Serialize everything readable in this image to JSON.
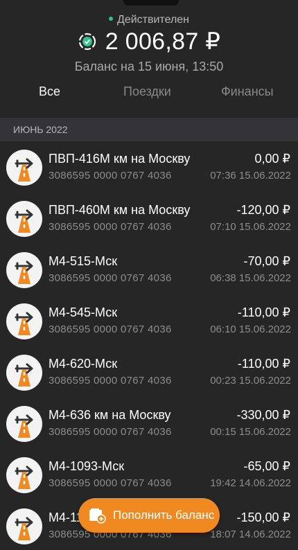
{
  "header": {
    "status": "Действителен",
    "balance": "2 006,87 ₽",
    "balance_date": "Баланс на 15 июня, 13:50"
  },
  "tabs": [
    {
      "label": "Все",
      "active": true
    },
    {
      "label": "Поездки",
      "active": false
    },
    {
      "label": "Финансы",
      "active": false
    }
  ],
  "month": "ИЮНЬ 2022",
  "transactions": [
    {
      "title": "ПВП-416М км на Москву",
      "card": "3086595 0000 0767 4036",
      "amount": "0,00 ₽",
      "datetime": "07:36 15.06.2022"
    },
    {
      "title": "ПВП-460М км на Москву",
      "card": "3086595 0000 0767 4036",
      "amount": "-120,00 ₽",
      "datetime": "07:10 15.06.2022"
    },
    {
      "title": "М4-515-Мск",
      "card": "3086595 0000 0767 4036",
      "amount": "-70,00 ₽",
      "datetime": "06:38 15.06.2022"
    },
    {
      "title": "М4-545-Мск",
      "card": "3086595 0000 0767 4036",
      "amount": "-110,00 ₽",
      "datetime": "06:10 15.06.2022"
    },
    {
      "title": "М4-620-Мск",
      "card": "3086595 0000 0767 4036",
      "amount": "-110,00 ₽",
      "datetime": "00:23 15.06.2022"
    },
    {
      "title": "М4-636 км на Москву",
      "card": "3086595 0000 0767 4036",
      "amount": "-330,00 ₽",
      "datetime": "00:15 15.06.2022"
    },
    {
      "title": "М4-1093-Мск",
      "card": "3086595 0000 0767 4036",
      "amount": "-65,00 ₽",
      "datetime": "19:42 14.06.2022"
    },
    {
      "title": "М4-11",
      "card": "3086595 0000 0767 4036",
      "amount": "-150,00 ₽",
      "datetime": "18:07 14.06.2022"
    }
  ],
  "fab": {
    "label": "Пополнить баланс"
  },
  "colors": {
    "accent": "#f08a20",
    "status": "#33c08a",
    "background": "#262626"
  }
}
